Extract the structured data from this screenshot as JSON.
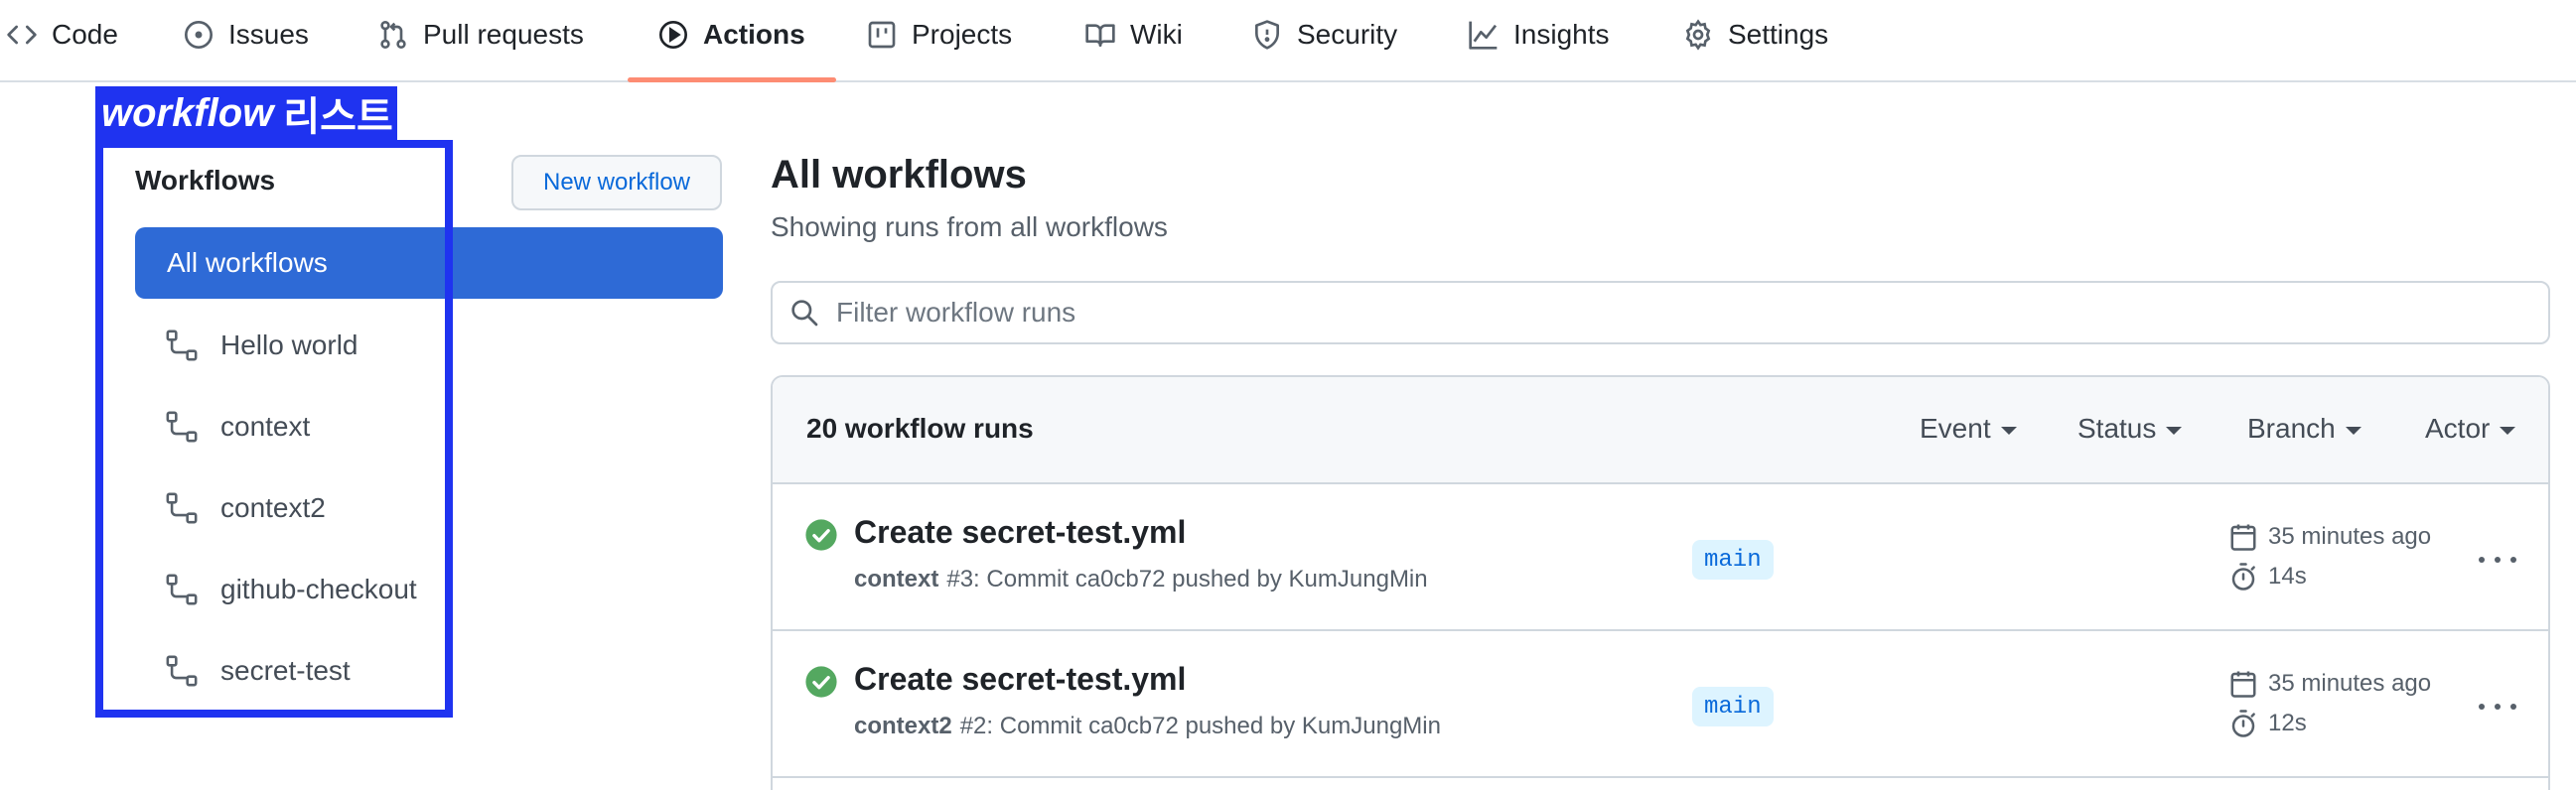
{
  "repo_nav": {
    "tabs": [
      {
        "label": "Code",
        "icon": "code-icon"
      },
      {
        "label": "Issues",
        "icon": "issue-opened-icon"
      },
      {
        "label": "Pull requests",
        "icon": "git-pull-request-icon"
      },
      {
        "label": "Actions",
        "icon": "play-icon",
        "active": true
      },
      {
        "label": "Projects",
        "icon": "table-icon"
      },
      {
        "label": "Wiki",
        "icon": "book-icon"
      },
      {
        "label": "Security",
        "icon": "shield-icon"
      },
      {
        "label": "Insights",
        "icon": "graph-icon"
      },
      {
        "label": "Settings",
        "icon": "gear-icon"
      }
    ]
  },
  "annotation": {
    "label_en": "workflow",
    "label_ko": "리스트",
    "color": "#1f33f0"
  },
  "sidebar": {
    "title": "Workflows",
    "new_workflow_label": "New workflow",
    "all_workflows_label": "All workflows",
    "workflows": [
      "Hello world",
      "context",
      "context2",
      "github-checkout",
      "secret-test"
    ]
  },
  "main": {
    "title": "All workflows",
    "subtitle": "Showing runs from all workflows",
    "filter_placeholder": "Filter workflow runs",
    "runs_count": "20 workflow runs",
    "filters": [
      "Event",
      "Status",
      "Branch",
      "Actor"
    ],
    "runs": [
      {
        "title": "Create secret-test.yml",
        "workflow": "context",
        "detail": "#3: Commit ca0cb72 pushed by KumJungMin",
        "branch": "main",
        "time_ago": "35 minutes ago",
        "duration": "14s",
        "status": "success"
      },
      {
        "title": "Create secret-test.yml",
        "workflow": "context2",
        "detail": "#2: Commit ca0cb72 pushed by KumJungMin",
        "branch": "main",
        "time_ago": "35 minutes ago",
        "duration": "12s",
        "status": "success"
      }
    ]
  },
  "colors": {
    "accent_blue": "#2e6ad6",
    "link_blue": "#0969da",
    "success_green": "#54a860",
    "tab_underline": "#fd8c73"
  }
}
